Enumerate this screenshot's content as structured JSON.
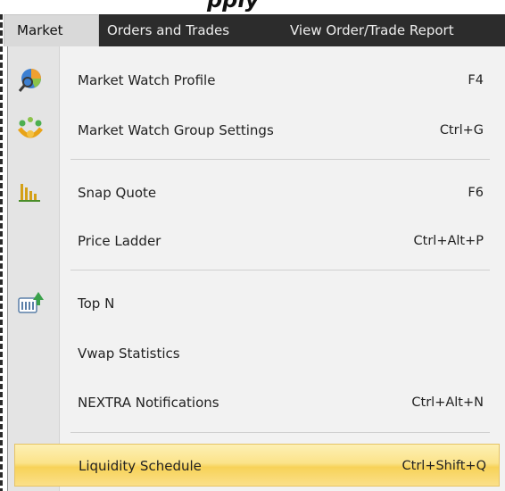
{
  "menubar": {
    "items": [
      {
        "label": "Market",
        "active": true
      },
      {
        "label": "Orders and Trades",
        "active": false
      },
      {
        "label": "View Order/Trade Report",
        "active": false
      }
    ]
  },
  "market_menu": {
    "items": [
      {
        "label": "Market Watch Profile",
        "shortcut": "F4",
        "icon": "market-watch-profile-icon"
      },
      {
        "label": "Market Watch Group Settings",
        "shortcut": "Ctrl+G",
        "icon": "group-settings-icon"
      },
      {
        "label": "Snap Quote",
        "shortcut": "F6",
        "icon": "snap-quote-icon"
      },
      {
        "label": "Price Ladder",
        "shortcut": "Ctrl+Alt+P",
        "icon": null
      },
      {
        "label": "Top N",
        "shortcut": "",
        "icon": "top-n-icon"
      },
      {
        "label": "Vwap Statistics",
        "shortcut": "",
        "icon": null
      },
      {
        "label": "NEXTRA Notifications",
        "shortcut": "Ctrl+Alt+N",
        "icon": null
      },
      {
        "label": "Liquidity Schedule",
        "shortcut": "Ctrl+Shift+Q",
        "icon": null,
        "highlighted": true
      }
    ]
  },
  "colors": {
    "menubar_bg": "#2c2c2c",
    "highlight": "#f9d96c"
  }
}
